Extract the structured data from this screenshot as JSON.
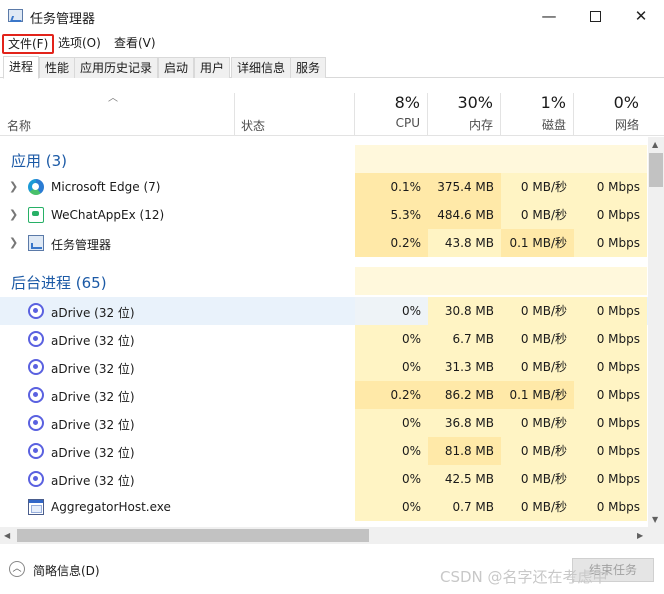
{
  "window": {
    "title": "任务管理器",
    "min_glyph": "—",
    "close_glyph": "✕"
  },
  "menu": {
    "file": "文件(F)",
    "options": "选项(O)",
    "view": "查看(V)"
  },
  "tabs": [
    "进程",
    "性能",
    "应用历史记录",
    "启动",
    "用户",
    "详细信息",
    "服务"
  ],
  "active_tab": "进程",
  "columns": {
    "name": "名称",
    "status": "状态",
    "cpu": {
      "pct": "8%",
      "label": "CPU"
    },
    "memory": {
      "pct": "30%",
      "label": "内存"
    },
    "disk": {
      "pct": "1%",
      "label": "磁盘"
    },
    "network": {
      "pct": "0%",
      "label": "网络"
    }
  },
  "groups": {
    "apps": "应用 (3)",
    "background": "后台进程 (65)"
  },
  "apps": [
    {
      "name": "Microsoft Edge (7)",
      "icon": "edge-icon",
      "cpu": "0.1%",
      "mem": "375.4 MB",
      "disk": "0 MB/秒",
      "net": "0 Mbps"
    },
    {
      "name": "WeChatAppEx (12)",
      "icon": "wechat-icon",
      "cpu": "5.3%",
      "mem": "484.6 MB",
      "disk": "0 MB/秒",
      "net": "0 Mbps"
    },
    {
      "name": "任务管理器",
      "icon": "task-manager-icon",
      "cpu": "0.2%",
      "mem": "43.8 MB",
      "disk": "0.1 MB/秒",
      "net": "0 Mbps"
    }
  ],
  "background": [
    {
      "name": "aDrive (32 位)",
      "icon": "adrive-icon",
      "cpu": "0%",
      "mem": "30.8 MB",
      "disk": "0 MB/秒",
      "net": "0 Mbps"
    },
    {
      "name": "aDrive (32 位)",
      "icon": "adrive-icon",
      "cpu": "0%",
      "mem": "6.7 MB",
      "disk": "0 MB/秒",
      "net": "0 Mbps"
    },
    {
      "name": "aDrive (32 位)",
      "icon": "adrive-icon",
      "cpu": "0%",
      "mem": "31.3 MB",
      "disk": "0 MB/秒",
      "net": "0 Mbps"
    },
    {
      "name": "aDrive (32 位)",
      "icon": "adrive-icon",
      "cpu": "0.2%",
      "mem": "86.2 MB",
      "disk": "0.1 MB/秒",
      "net": "0 Mbps"
    },
    {
      "name": "aDrive (32 位)",
      "icon": "adrive-icon",
      "cpu": "0%",
      "mem": "36.8 MB",
      "disk": "0 MB/秒",
      "net": "0 Mbps"
    },
    {
      "name": "aDrive (32 位)",
      "icon": "adrive-icon",
      "cpu": "0%",
      "mem": "81.8 MB",
      "disk": "0 MB/秒",
      "net": "0 Mbps"
    },
    {
      "name": "aDrive (32 位)",
      "icon": "adrive-icon",
      "cpu": "0%",
      "mem": "42.5 MB",
      "disk": "0 MB/秒",
      "net": "0 Mbps"
    },
    {
      "name": "AggregatorHost.exe",
      "icon": "aggregator-icon",
      "cpu": "0%",
      "mem": "0.7 MB",
      "disk": "0 MB/秒",
      "net": "0 Mbps"
    }
  ],
  "footer": {
    "fewer_details": "简略信息(D)",
    "end_task": "结束任务",
    "watermark": "CSDN @名字还在考虑中"
  },
  "colors": {
    "heat_light": "#fff4c4",
    "heat_dark": "#ffe9a8",
    "group_title": "#1c5aa6",
    "selection": "#e9f2fb",
    "highlight_box": "#e2231a"
  }
}
